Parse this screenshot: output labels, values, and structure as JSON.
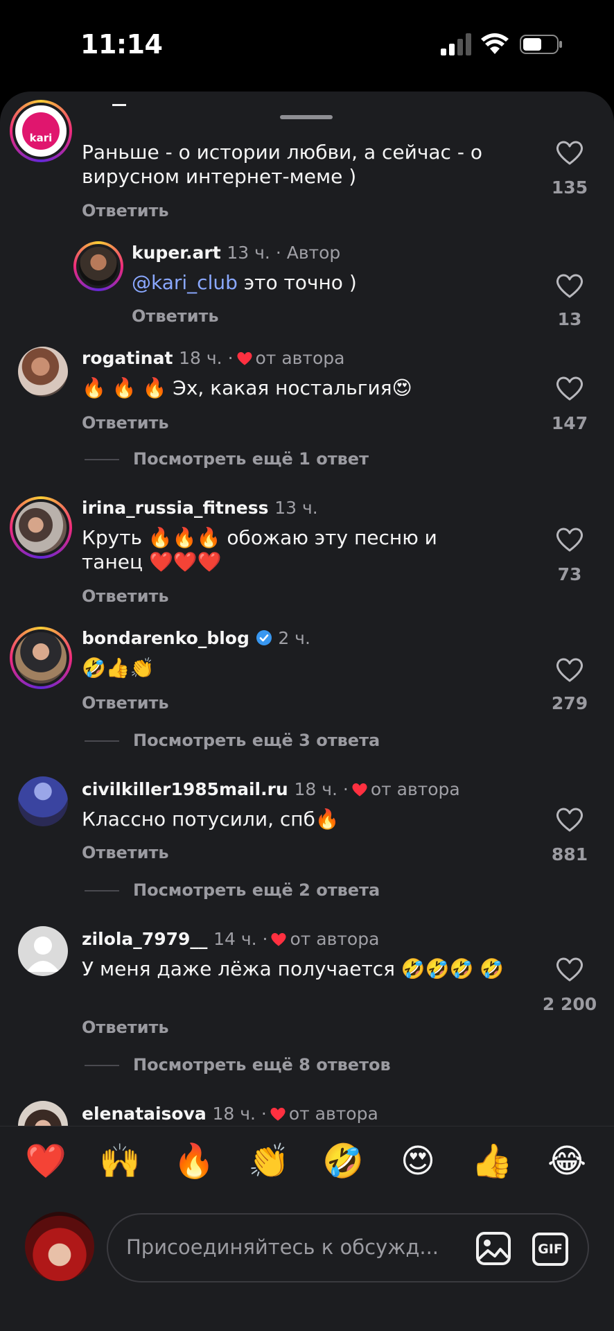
{
  "status_bar": {
    "time": "11:14"
  },
  "comments": [
    {
      "username": "",
      "meta": "",
      "text": "Раньше - о истории любви, а сейчас - о вирусном интернет-меме )",
      "reply": "Ответить",
      "likes": "135",
      "avatar_text": "kari"
    },
    {
      "username": "kuper.art",
      "meta": "13 ч. · Автор",
      "mention": "@kari_club",
      "text": "это точно )",
      "reply": "Ответить",
      "likes": "13"
    },
    {
      "username": "rogatinat",
      "meta_time": "18 ч. ·",
      "meta_author": "от автора",
      "emoji": "🔥 🔥 🔥",
      "text": "Эх, какая ностальгия😍",
      "reply": "Ответить",
      "likes": "147",
      "more": "Посмотреть ещё 1 ответ"
    },
    {
      "username": "irina_russia_fitness",
      "meta": "13 ч.",
      "text": "Круть 🔥🔥🔥 обожаю эту песню и танец ❤️❤️❤️",
      "reply": "Ответить",
      "likes": "73"
    },
    {
      "username": "bondarenko_blog",
      "meta": "2 ч.",
      "text": "🤣👍👏",
      "reply": "Ответить",
      "likes": "279",
      "more": "Посмотреть ещё 3 ответа"
    },
    {
      "username": "civilkiller1985mail.ru",
      "meta_time": "18 ч. ·",
      "meta_author": "от автора",
      "text": "Классно потусили, спб🔥",
      "reply": "Ответить",
      "likes": "881",
      "more": "Посмотреть ещё 2 ответа"
    },
    {
      "username": "zilola_7979__",
      "meta_time": "14 ч. ·",
      "meta_author": "от автора",
      "text": "У меня даже лёжа получается 🤣🤣🤣 🤣",
      "reply": "Ответить",
      "likes": "2 200",
      "more": "Посмотреть ещё 8 ответов"
    },
    {
      "username": "elenataisova",
      "meta_time": "18 ч. ·",
      "meta_author": "от автора"
    }
  ],
  "reactions": [
    "❤️",
    "🙌",
    "🔥",
    "👏",
    "🤣",
    "😍",
    "👍",
    "😂"
  ],
  "composer": {
    "placeholder": "Присоединяйтесь к обсужд...",
    "gif_label": "GIF"
  },
  "colors": {
    "background": "#1c1d20",
    "heart_red": "#ff3040",
    "mention": "#8aa8ff",
    "verified": "#3897f0"
  }
}
